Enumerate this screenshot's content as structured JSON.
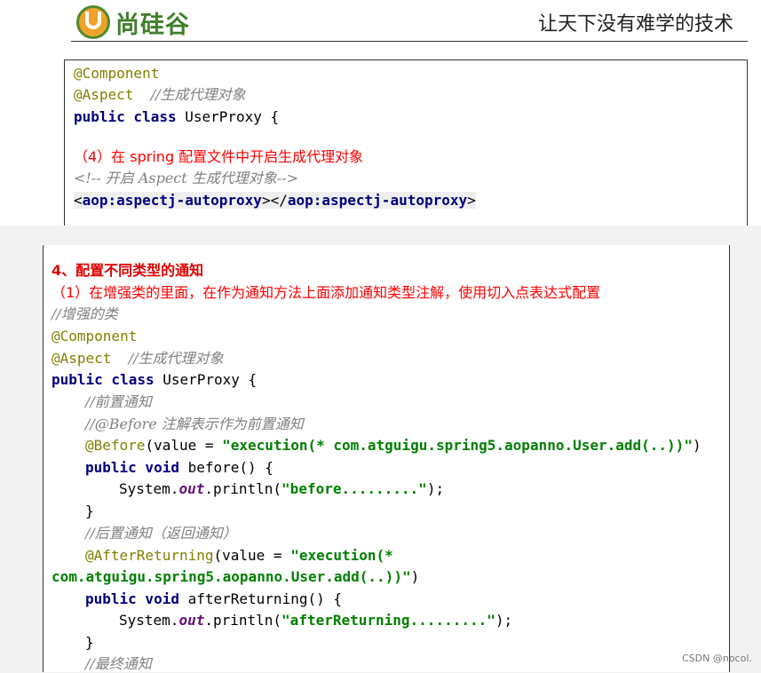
{
  "header": {
    "logo_text": "尚硅谷",
    "slogan": "让天下没有难学的技术"
  },
  "box1": {
    "l1": "@Component",
    "l2_ann": "@Aspect",
    "l2_cmt": "//生成代理对象",
    "l3_kw": "public class",
    "l3_rest": " UserProxy {",
    "l4_a": "（4）在 ",
    "l4_b": "spring",
    "l4_c": " 配置文件中开启生成代理对象",
    "l5": "<!-- 开启 Aspect 生成代理对象-->",
    "l6_tag": "aop:aspectj-autoproxy",
    "l6_open": "<",
    "l6_mid": "></",
    "l6_close": ">"
  },
  "box2": {
    "title": "4、配置不同类型的通知",
    "subtitle": "（1）在增强类的里面，在作为通知方法上面添加通知类型注解，使用切入点表达式配置",
    "c1": "//增强的类",
    "c2": "@Component",
    "c3_ann": "@Aspect",
    "c3_cmt": "//生成代理对象",
    "c4_kw": "public class",
    "c4_rest": " UserProxy {",
    "c5": "//前置通知",
    "c6": "//@Before 注解表示作为前置通知",
    "c7_ann": "@Before",
    "c7_mid": "(value = ",
    "c7_str": "\"execution(* com.atguigu.spring5.aopanno.User.add(..))\"",
    "c7_end": ")",
    "c8_kw": "public void",
    "c8_rest": " before() {",
    "c9_a": "System.",
    "c9_fld": "out",
    "c9_b": ".println(",
    "c9_str": "\"before.........\"",
    "c9_end": ");",
    "c10": "}",
    "c11": "//后置通知（返回通知）",
    "c12_ann": "@AfterReturning",
    "c12_mid": "(value = ",
    "c12_str": "\"execution(*",
    "c13_str": "com.atguigu.spring5.aopanno.User.add(..))\"",
    "c13_end": ")",
    "c14_kw": "public void",
    "c14_rest": " afterReturning() {",
    "c15_a": "System.",
    "c15_fld": "out",
    "c15_b": ".println(",
    "c15_str": "\"afterReturning.........\"",
    "c15_end": ");",
    "c16": "}",
    "c17": "//最终通知"
  },
  "watermark": "CSDN @nocol."
}
